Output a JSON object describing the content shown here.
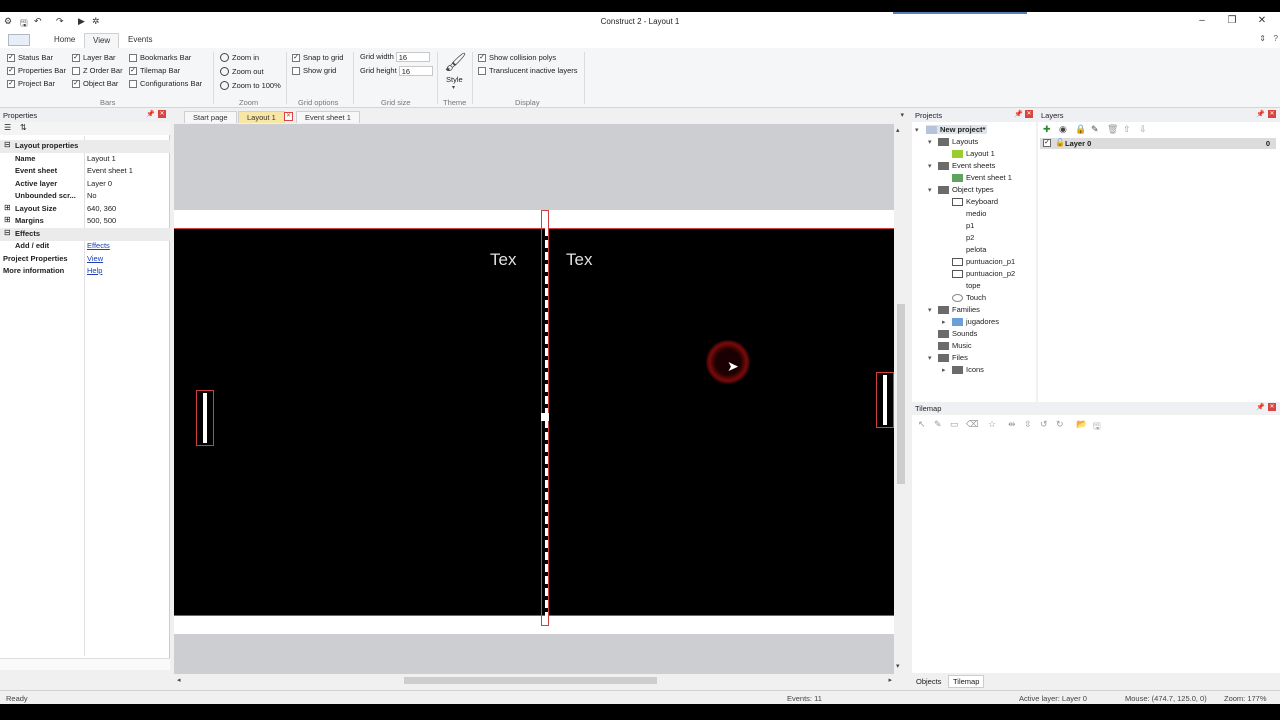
{
  "window": {
    "title": "Construct 2 - Layout 1",
    "controls": [
      "minimize-icon",
      "maximize-icon",
      "close-icon"
    ]
  },
  "ribbon": {
    "tabs": [
      "Home",
      "View",
      "Events"
    ],
    "active_tab": "View",
    "bars": [
      {
        "label": "Status Bar",
        "checked": true
      },
      {
        "label": "Properties Bar",
        "checked": true
      },
      {
        "label": "Project Bar",
        "checked": true
      },
      {
        "label": "Layer Bar",
        "checked": true
      },
      {
        "label": "Z Order Bar",
        "checked": false
      },
      {
        "label": "Object Bar",
        "checked": true
      },
      {
        "label": "Bookmarks Bar",
        "checked": false
      },
      {
        "label": "Tilemap Bar",
        "checked": true
      },
      {
        "label": "Configurations Bar",
        "checked": false
      }
    ],
    "bars_group": "Bars",
    "zoom": {
      "group": "Zoom",
      "items": [
        "Zoom in",
        "Zoom out",
        "Zoom to 100%"
      ]
    },
    "grid_options": {
      "group": "Grid options",
      "snap_to_grid": "Snap to grid",
      "snap_checked": true,
      "show_grid": "Show grid",
      "show_grid_checked": false
    },
    "grid_size": {
      "group": "Grid size",
      "width_label": "Grid width",
      "width_value": "16",
      "height_label": "Grid height",
      "height_value": "16"
    },
    "theme": {
      "group": "Theme",
      "style_label": "Style"
    },
    "display": {
      "group": "Display",
      "collision": "Show collision polys",
      "collision_checked": true,
      "translucent": "Translucent inactive layers",
      "translucent_checked": false
    }
  },
  "properties": {
    "title": "Properties",
    "section_layout": "Layout properties",
    "rows": [
      {
        "key": "Name",
        "value": "Layout 1"
      },
      {
        "key": "Event sheet",
        "value": "Event sheet 1"
      },
      {
        "key": "Active layer",
        "value": "Layer 0"
      },
      {
        "key": "Unbounded scr...",
        "value": "No"
      },
      {
        "key": "Layout Size",
        "value": "640, 360"
      },
      {
        "key": "Margins",
        "value": "500, 500"
      }
    ],
    "section_effects": "Effects",
    "effects_row": {
      "key": "Add / edit",
      "value": "Effects"
    },
    "project_props": {
      "key": "Project Properties",
      "value": "View"
    },
    "more_info": {
      "key": "More information",
      "value": "Help"
    }
  },
  "doc_tabs": [
    "Start page",
    "Layout 1",
    "Event sheet 1"
  ],
  "active_doc_tab": "Layout 1",
  "canvas": {
    "score_left": "Tex",
    "score_right": "Tex"
  },
  "projects": {
    "title": "Projects",
    "root": "New project*",
    "layouts": "Layouts",
    "layout_1": "Layout 1",
    "event_sheets": "Event sheets",
    "event_sheet_1": "Event sheet 1",
    "object_types": "Object types",
    "objects": [
      "Keyboard",
      "medio",
      "p1",
      "p2",
      "pelota",
      "puntuacion_p1",
      "puntuacion_p2",
      "tope",
      "Touch"
    ],
    "families": "Families",
    "family_1": "jugadores",
    "sounds": "Sounds",
    "music": "Music",
    "files": "Files",
    "icons": "Icons"
  },
  "layers": {
    "title": "Layers",
    "items": [
      {
        "name": "Layer 0",
        "count": "0"
      }
    ]
  },
  "tilemap": {
    "title": "Tilemap"
  },
  "bottom_tabs": [
    "Objects",
    "Tilemap"
  ],
  "status": {
    "ready": "Ready",
    "events": "Events: 11",
    "active_layer": "Active layer: Layer 0",
    "mouse": "Mouse: (474.7, 125.0, 0)",
    "zoom": "Zoom: 177%"
  }
}
